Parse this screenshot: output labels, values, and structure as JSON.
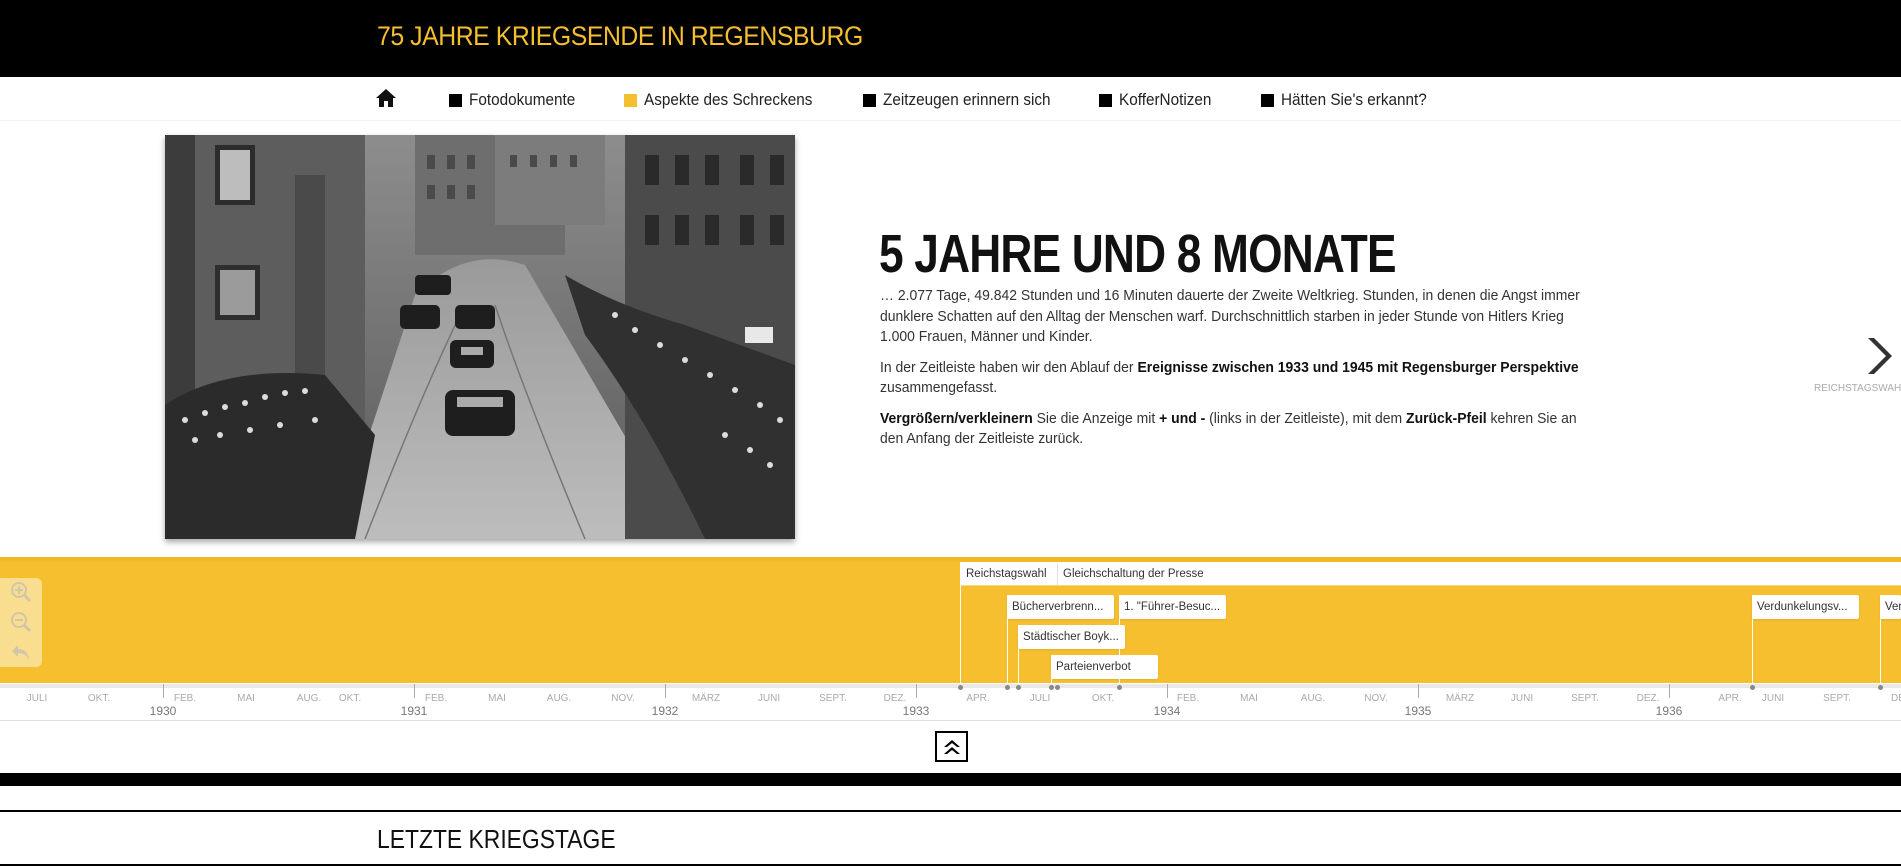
{
  "header": {
    "site_title": "75 JAHRE KRIEGSENDE IN REGENSBURG"
  },
  "nav": {
    "home_icon": "home-icon",
    "items": [
      {
        "label": "Fotodokumente",
        "active": false
      },
      {
        "label": "Aspekte des Schreckens",
        "active": true
      },
      {
        "label": "Zeitzeugen erinnern sich",
        "active": false
      },
      {
        "label": "KofferNotizen",
        "active": false
      },
      {
        "label": "Hätten Sie's erkannt?",
        "active": false
      }
    ]
  },
  "hero": {
    "headline": "5 JAHRE UND 8 MONATE",
    "p1": "… 2.077 Tage, 49.842 Stunden und 16 Minuten dauerte der Zweite Weltkrieg. Stunden, in denen die Angst immer dunklere Schatten auf den Alltag der Menschen warf. Durchschnittlich starben in jeder Stunde von Hitlers Krieg 1.000 Frauen, Männer und Kinder.",
    "p2_before": "In der Zeitleiste haben wir den Ablauf der ",
    "p2_bold": "Ereignisse zwischen 1933 und 1945 mit Regensburger Perspektive",
    "p2_after": " zusammengefasst.",
    "p3_bold1": "Vergrößern/verkleinern",
    "p3_text1": " Sie die Anzeige mit ",
    "p3_bold2": "+ und -",
    "p3_text2": " (links in der Zeitleiste), mit dem ",
    "p3_bold3": "Zurück-Pfeil",
    "p3_text3": " kehren Sie an den Anfang der Zeitleiste zurück."
  },
  "next": {
    "label": "REICHSTAGSWAHL"
  },
  "timeline": {
    "events": {
      "reichstagswahl": "Reichstagswahl",
      "gleichschaltung": "Gleichschaltung der Presse",
      "buecher": "Bücherverbrenn...",
      "fuehrer": "1. \"Führer-Besuc...",
      "boykott": "Städtischer Boyk...",
      "parteien": "Parteienverbot",
      "verdunkelung": "Verdunkelungsv...",
      "ver": "Ver"
    },
    "ticks": [
      "JULI",
      "OKT.",
      "FEB.",
      "MAI",
      "AUG.",
      "OKT.",
      "FEB.",
      "MAI",
      "AUG.",
      "NOV.",
      "MÄRZ",
      "JUNI",
      "SEPT.",
      "DEZ.",
      "APR.",
      "JULI",
      "OKT.",
      "FEB.",
      "MAI",
      "AUG.",
      "NOV.",
      "MÄRZ",
      "JUNI",
      "SEPT.",
      "DEZ.",
      "APR.",
      "JUNI",
      "SEPT.",
      "DE"
    ],
    "years": [
      "1930",
      "1931",
      "1932",
      "1933",
      "1934",
      "1935",
      "1936"
    ]
  },
  "section": {
    "title": "LETZTE KRIEGSTAGE"
  },
  "colors": {
    "accent": "#f6bf30",
    "header_bg": "#000000"
  }
}
